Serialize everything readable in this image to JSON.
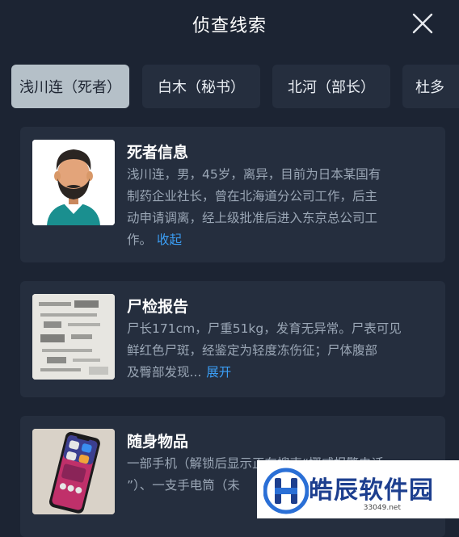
{
  "header": {
    "title": "侦查线索"
  },
  "icons": {
    "close": "close-icon",
    "portrait": "portrait-avatar-icon",
    "report": "document-photo",
    "phone": "phone-photo",
    "watermark_logo": "watermark-logo"
  },
  "tabs": [
    {
      "label": "浅川连（死者）",
      "active": true
    },
    {
      "label": "白木（秘书）",
      "active": false
    },
    {
      "label": "北河（部长）",
      "active": false
    },
    {
      "label": "杜多",
      "active": false
    }
  ],
  "cards": [
    {
      "title": "死者信息",
      "lines": [
        "浅川连，男，45岁，离异，目前为日本某国有",
        "制药企业社长，曾在北海道分公司工作，后主",
        "动申请调离，经上级批准后进入东京总公司工",
        "作。"
      ],
      "link": "收起"
    },
    {
      "title": "尸检报告",
      "lines": [
        "尸长171cm，尸重51kg，发育无异常。尸表可见",
        "鲜红色尸斑，经鉴定为轻度冻伤征；尸体腹部",
        "及臀部发现..."
      ],
      "link": "展开"
    },
    {
      "title": "随身物品",
      "lines": [
        "一部手机（解锁后显示正在搜索“挪威报警电话",
        "”）、一支手电筒（未"
      ]
    }
  ],
  "watermark": {
    "name": "皓辰软件园",
    "url": "33049.net"
  },
  "colors": {
    "background": "#1c2433",
    "card": "#252e3e",
    "active_tab": "#b5c0c8",
    "link": "#3b9ef5",
    "body_text": "#9aa6b5"
  }
}
